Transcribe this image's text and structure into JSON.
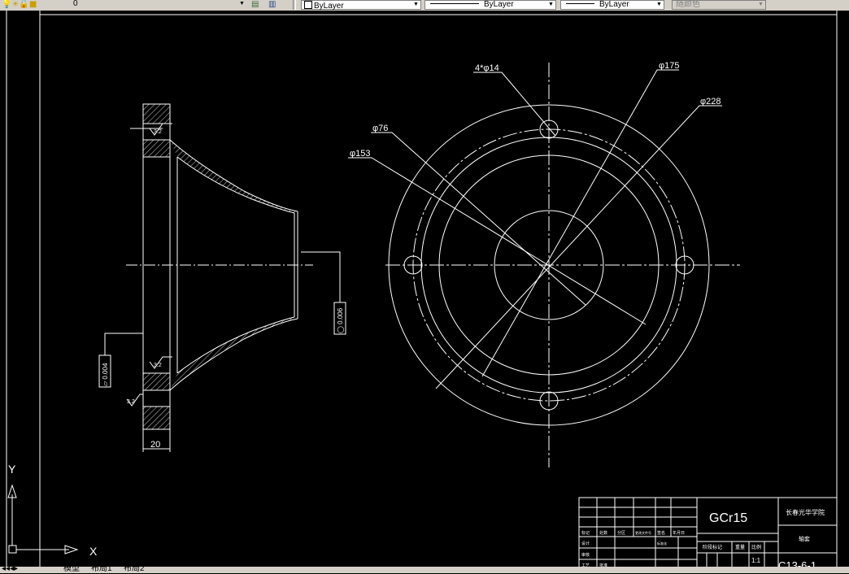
{
  "toolbar": {
    "layer_name": "0",
    "color_control": "ByLayer",
    "linetype_control": "ByLayer",
    "lineweight_control": "ByLayer",
    "plotstyle_control": "随颜色"
  },
  "drawing": {
    "side_view": {
      "width_dim": "20",
      "roughness_top": "3.2",
      "roughness_bottom": "3.2",
      "roughness_flange": "3.2",
      "tol_flatness": "▱ 0.004",
      "tol_circularity": "◯ 0.006"
    },
    "front_view": {
      "hole_label": "4*φ14",
      "dia_175": "φ175",
      "dia_228": "φ228",
      "dia_76": "φ76",
      "dia_153": "φ153"
    },
    "title_block": {
      "material": "GCr15",
      "school": "长春光华学院",
      "part_name": "轴套",
      "scale": "1:1",
      "drawing_no": "C13-6-1",
      "stage_label": "阶段标记",
      "weight_label": "重量",
      "scale_label": "比例",
      "cells": [
        "标记",
        "处数",
        "分区",
        "更改文件号",
        "签名",
        "年月日",
        "设计",
        "标准化",
        "审核",
        "工艺",
        "批准"
      ]
    },
    "ucs": {
      "x_label": "X",
      "y_label": "Y"
    }
  },
  "tabs": {
    "model": "模型",
    "layout1": "布局1",
    "layout2": "布局2"
  }
}
